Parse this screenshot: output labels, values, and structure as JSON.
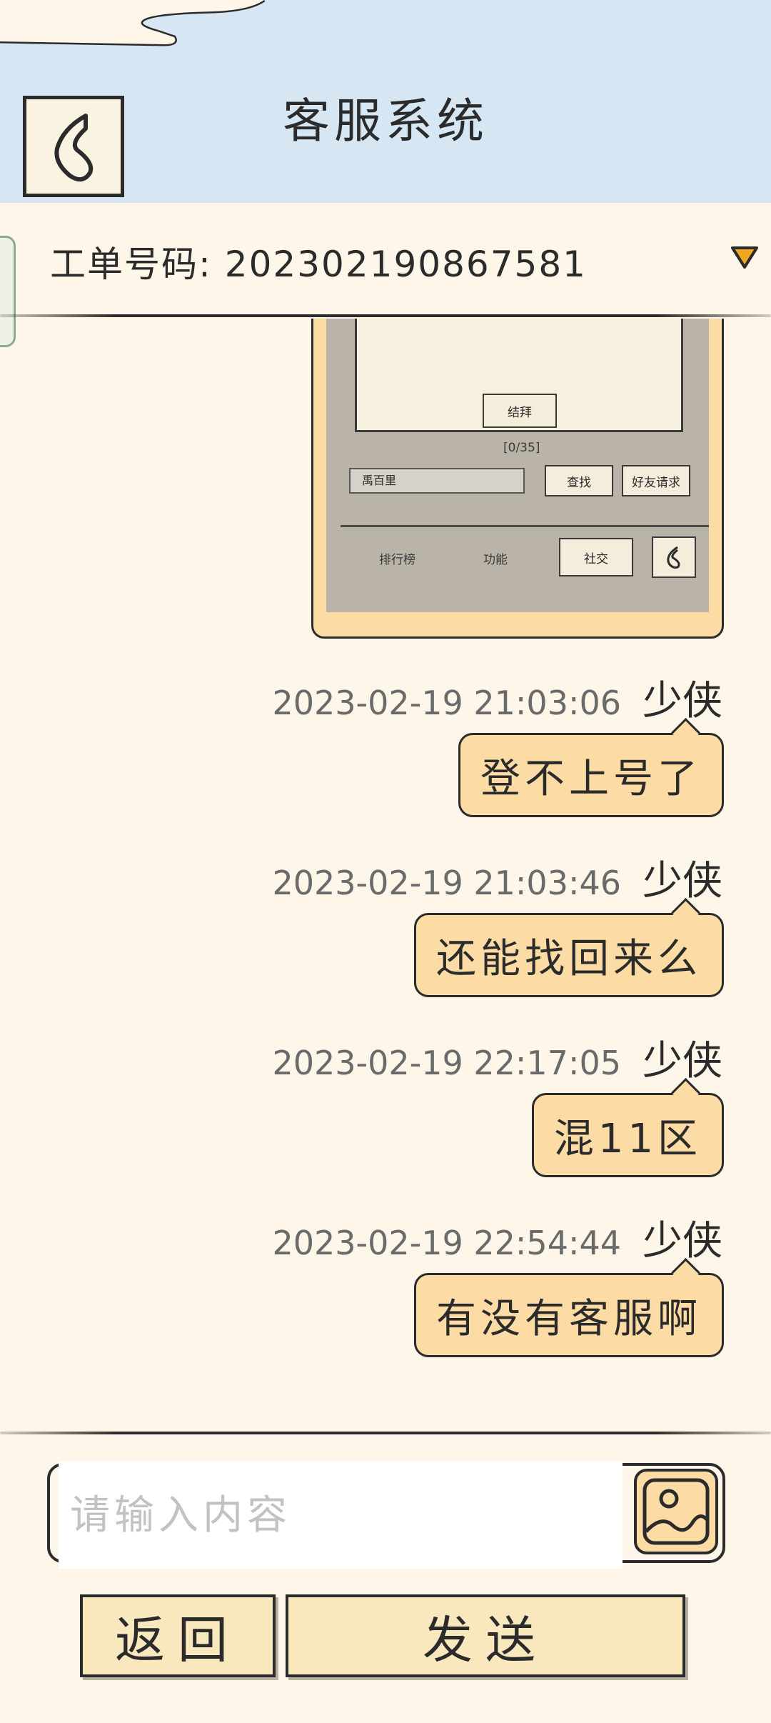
{
  "header": {
    "title": "客服系统"
  },
  "ticket": {
    "label": "工单号码:",
    "number": "202302190867581"
  },
  "screenshot_preview": {
    "panel_button": "结拜",
    "counter": "[0/35]",
    "search_value": "禹百里",
    "search_button": "查找",
    "friend_request_button": "好友请求",
    "tabs": [
      "排行榜",
      "功能",
      "社交"
    ]
  },
  "messages": [
    {
      "time": "2023-02-19 21:03:06",
      "sender": "少侠",
      "text": "登不上号了"
    },
    {
      "time": "2023-02-19 21:03:46",
      "sender": "少侠",
      "text": "还能找回来么"
    },
    {
      "time": "2023-02-19 22:17:05",
      "sender": "少侠",
      "text": "混11区"
    },
    {
      "time": "2023-02-19 22:54:44",
      "sender": "少侠",
      "text": "有没有客服啊"
    }
  ],
  "composer": {
    "placeholder": "请输入内容"
  },
  "actions": {
    "back_label": "返回",
    "send_label": "发送"
  }
}
